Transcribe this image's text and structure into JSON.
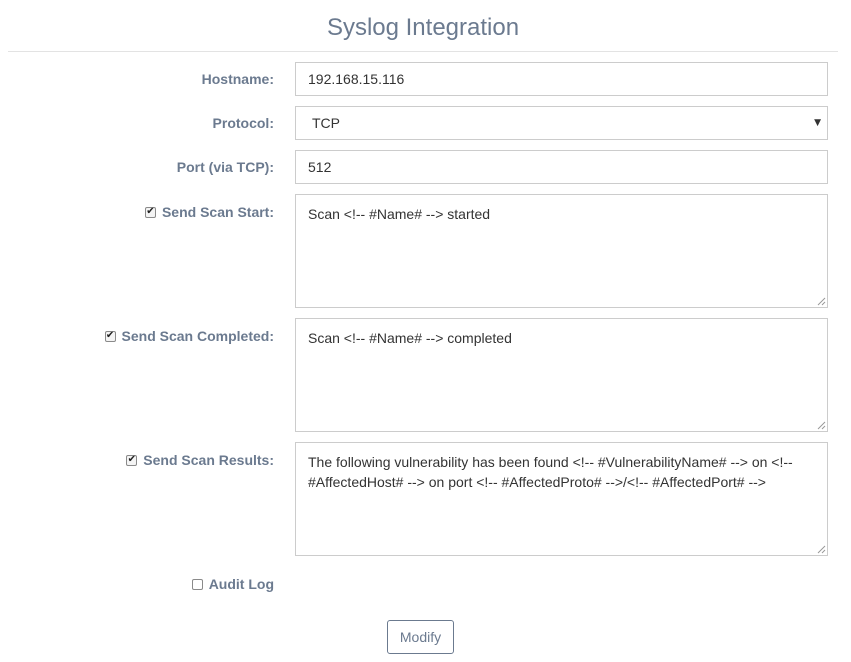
{
  "page": {
    "title": "Syslog Integration"
  },
  "form": {
    "hostname": {
      "label": "Hostname:",
      "value": "192.168.15.116"
    },
    "protocol": {
      "label": "Protocol:",
      "value": "TCP"
    },
    "port": {
      "label": "Port (via TCP):",
      "value": "512"
    },
    "scan_start": {
      "label": "Send Scan Start:",
      "checked": true,
      "value": "Scan <!-- #Name# --> started"
    },
    "scan_completed": {
      "label": "Send Scan Completed:",
      "checked": true,
      "value": "Scan <!-- #Name# --> completed"
    },
    "scan_results": {
      "label": "Send Scan Results:",
      "checked": true,
      "value": "The following vulnerability has been found <!-- #VulnerabilityName# --> on <!-- #AffectedHost# --> on port <!-- #AffectedProto# -->/<!-- #AffectedPort# -->"
    },
    "audit_log": {
      "label": "Audit Log",
      "checked": false
    }
  },
  "actions": {
    "modify_label": "Modify"
  },
  "icons": {
    "checkbox_checked": "checkmark-icon",
    "select_caret": "caret-down-icon",
    "resize_grip": "resize-grip-icon"
  },
  "colors": {
    "label": "#6b7a8f",
    "text": "#333333",
    "border": "#cccccc"
  }
}
